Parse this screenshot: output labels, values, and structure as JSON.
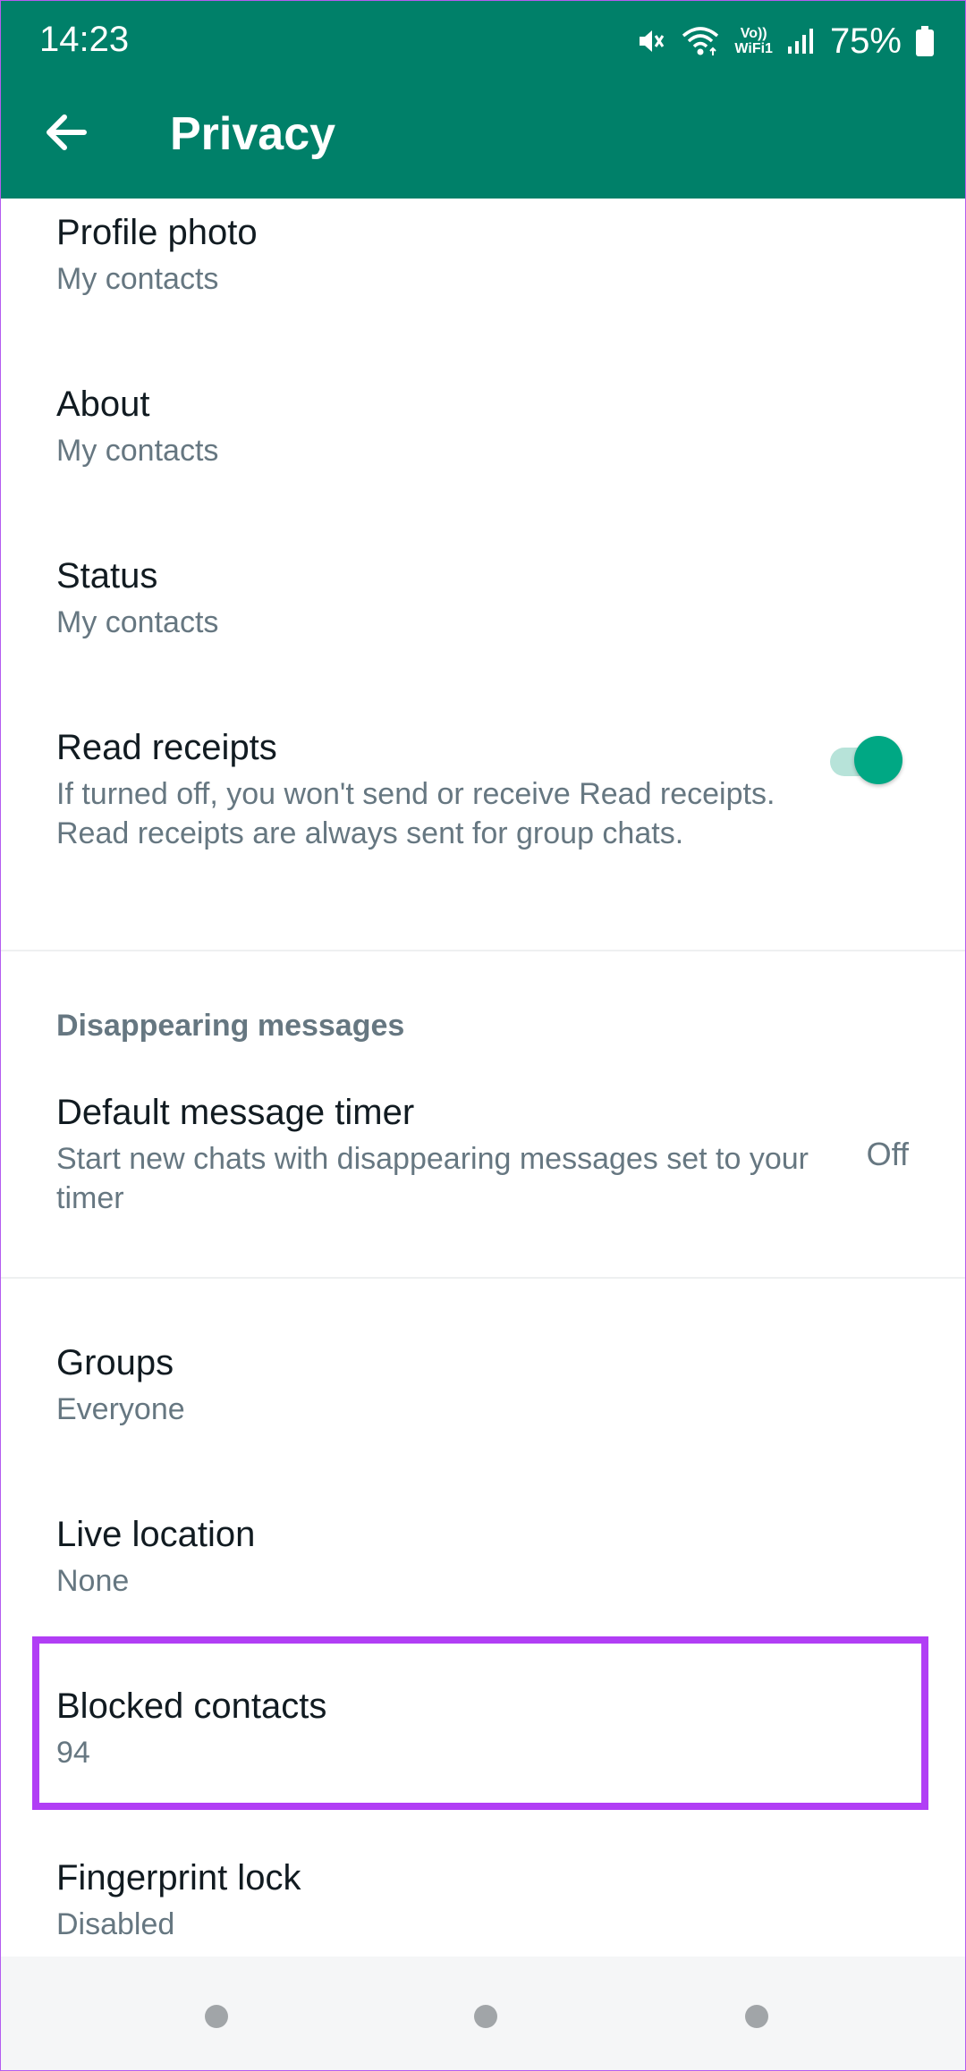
{
  "status_bar": {
    "time": "14:23",
    "battery": "75%",
    "volte_line1": "Vo))",
    "volte_line2": "WiFi1"
  },
  "toolbar": {
    "title": "Privacy"
  },
  "items": [
    {
      "title": "Profile photo",
      "subtitle": "My contacts"
    },
    {
      "title": "About",
      "subtitle": "My contacts"
    },
    {
      "title": "Status",
      "subtitle": "My contacts"
    },
    {
      "title": "Read receipts",
      "subtitle": "If turned off, you won't send or receive Read receipts. Read receipts are always sent for group chats.",
      "enabled": true
    }
  ],
  "disappearing": {
    "header": "Disappearing messages",
    "timer_title": "Default message timer",
    "timer_subtitle": "Start new chats with disappearing messages set to your timer",
    "timer_value": "Off"
  },
  "more_items": [
    {
      "title": "Groups",
      "subtitle": "Everyone"
    },
    {
      "title": "Live location",
      "subtitle": "None"
    },
    {
      "title": "Blocked contacts",
      "subtitle": "94"
    },
    {
      "title": "Fingerprint lock",
      "subtitle": "Disabled"
    }
  ],
  "colors": {
    "primary": "#008069",
    "accent": "#00a884",
    "highlight": "#b13ef5",
    "secondary_text": "#667781"
  }
}
